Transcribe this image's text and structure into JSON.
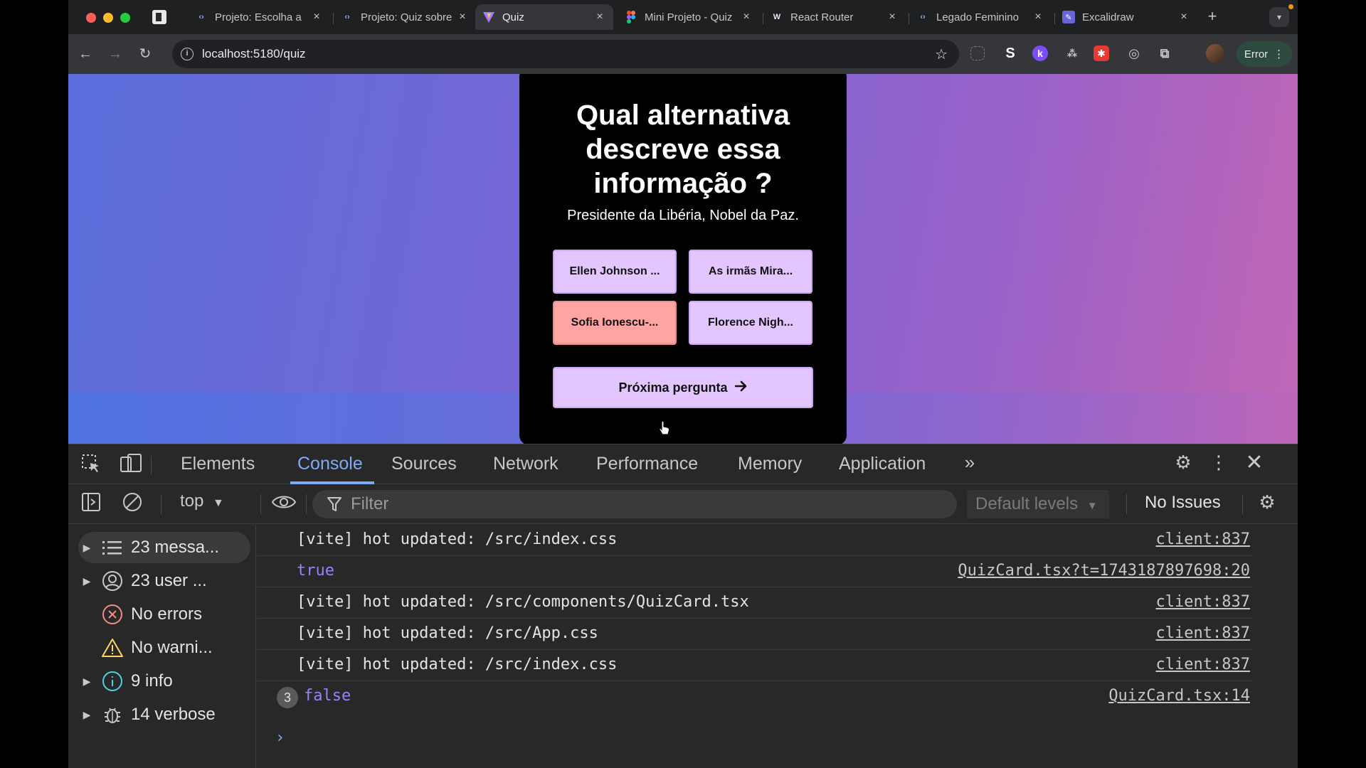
{
  "browser": {
    "tabs": [
      {
        "title": "Projeto: Escolha a",
        "favicon": "code-icon",
        "active": false
      },
      {
        "title": "Projeto: Quiz sobre",
        "favicon": "code-icon",
        "active": false
      },
      {
        "title": "Quiz",
        "favicon": "vite-icon",
        "active": true
      },
      {
        "title": "Mini Projeto - Quiz",
        "favicon": "figma-icon",
        "active": false
      },
      {
        "title": "React Router",
        "favicon": "remix-icon",
        "active": false
      },
      {
        "title": "Legado Feminino",
        "favicon": "code-icon",
        "active": false
      },
      {
        "title": "Excalidraw",
        "favicon": "excalidraw-icon",
        "active": false
      }
    ],
    "url": "localhost:5180/quiz",
    "error_label": "Error"
  },
  "quiz": {
    "question": "Qual alternativa descreve essa informação ?",
    "info": "Presidente da Libéria, Nobel da Paz.",
    "options": [
      {
        "label": "Ellen Johnson ...",
        "state": "default"
      },
      {
        "label": "As irmãs Mira...",
        "state": "default"
      },
      {
        "label": "Sofia Ionescu-...",
        "state": "wrong"
      },
      {
        "label": "Florence Nigh...",
        "state": "default"
      }
    ],
    "next_label": "Próxima pergunta",
    "colors": {
      "option": "#e3c6ff",
      "wrong": "#ffa3a3"
    }
  },
  "devtools": {
    "tabs": [
      "Elements",
      "Console",
      "Sources",
      "Network",
      "Performance",
      "Memory",
      "Application"
    ],
    "active_tab": "Console",
    "context": "top",
    "filter_placeholder": "Filter",
    "levels": "Default levels",
    "issues": "No Issues",
    "sidebar": [
      {
        "label": "23 messa...",
        "icon": "list-icon",
        "expandable": true
      },
      {
        "label": "23 user ...",
        "icon": "user-icon",
        "expandable": true
      },
      {
        "label": "No errors",
        "icon": "error-icon",
        "expandable": false
      },
      {
        "label": "No warni...",
        "icon": "warning-icon",
        "expandable": false
      },
      {
        "label": "9 info",
        "icon": "info-icon",
        "expandable": true
      },
      {
        "label": "14 verbose",
        "icon": "bug-icon",
        "expandable": true
      }
    ],
    "logs": [
      {
        "message": "[vite] hot updated: /src/index.css",
        "source": "client:837",
        "type": "text"
      },
      {
        "message": "true",
        "source": "QuizCard.tsx?t=1743187897698:20",
        "type": "bool"
      },
      {
        "message": "[vite] hot updated: /src/components/QuizCard.tsx",
        "source": "client:837",
        "type": "text"
      },
      {
        "message": "[vite] hot updated: /src/App.css",
        "source": "client:837",
        "type": "text"
      },
      {
        "message": "[vite] hot updated: /src/index.css",
        "source": "client:837",
        "type": "text"
      },
      {
        "message": "false",
        "source": "QuizCard.tsx:14",
        "type": "bool",
        "count": "3"
      }
    ]
  }
}
